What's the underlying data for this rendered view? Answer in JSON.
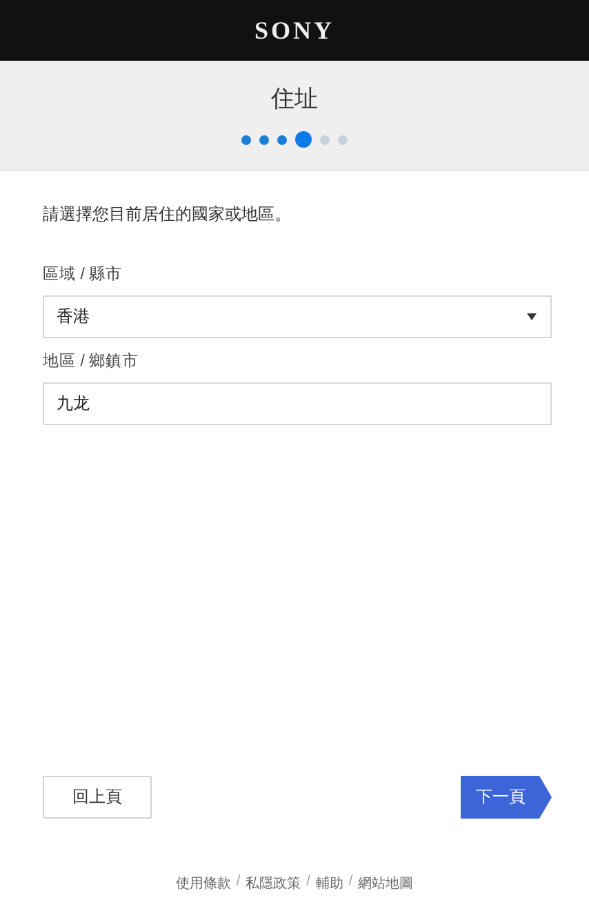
{
  "header": {
    "logo": "SONY"
  },
  "page": {
    "title": "住址",
    "steps": [
      {
        "done": true,
        "selected": false
      },
      {
        "done": true,
        "selected": false
      },
      {
        "done": true,
        "selected": false
      },
      {
        "done": false,
        "selected": true
      },
      {
        "done": false,
        "selected": false
      },
      {
        "done": false,
        "selected": false
      }
    ]
  },
  "form": {
    "instruction": "請選擇您目前居住的國家或地區。",
    "fields": [
      {
        "kind": "select",
        "label": "區域 / 縣市",
        "value": "香港"
      },
      {
        "kind": "text",
        "label": "地區 / 鄉鎮市",
        "value": "九龙"
      }
    ]
  },
  "buttons": [
    {
      "kind": "back",
      "label": "回上頁"
    },
    {
      "kind": "next",
      "label": "下一頁"
    }
  ],
  "footer": [
    {
      "kind": "link",
      "text": "使用條款"
    },
    {
      "kind": "separator",
      "text": "/"
    },
    {
      "kind": "link",
      "text": "私隱政策"
    },
    {
      "kind": "separator",
      "text": "/"
    },
    {
      "kind": "link",
      "text": "輔助"
    },
    {
      "kind": "separator",
      "text": "/"
    },
    {
      "kind": "link",
      "text": "網站地圖"
    }
  ]
}
